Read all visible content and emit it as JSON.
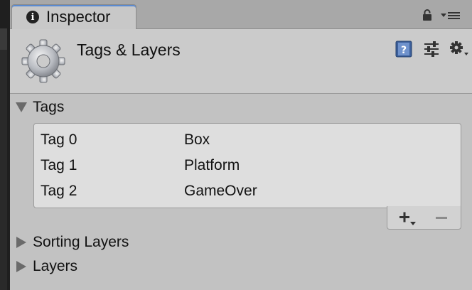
{
  "tab": {
    "label": "Inspector",
    "info_glyph": "i"
  },
  "header": {
    "title": "Tags & Layers"
  },
  "icons": {
    "tab": [
      "info-icon",
      "lock-icon",
      "tab-menu-icon"
    ],
    "header": [
      "gear-icon",
      "help-icon",
      "preset-icon",
      "settings-icon"
    ],
    "list": [
      "plus-icon",
      "minus-icon"
    ]
  },
  "sections": {
    "tags": {
      "label": "Tags",
      "expanded": true,
      "rows": [
        {
          "name": "Tag 0",
          "value": "Box"
        },
        {
          "name": "Tag 1",
          "value": "Platform"
        },
        {
          "name": "Tag 2",
          "value": "GameOver"
        }
      ]
    },
    "sorting_layers": {
      "label": "Sorting Layers",
      "expanded": false
    },
    "layers": {
      "label": "Layers",
      "expanded": false
    }
  },
  "colors": {
    "accent": "#5a8ad0",
    "panel": "#c2c2c2",
    "list_bg": "#dedede"
  }
}
